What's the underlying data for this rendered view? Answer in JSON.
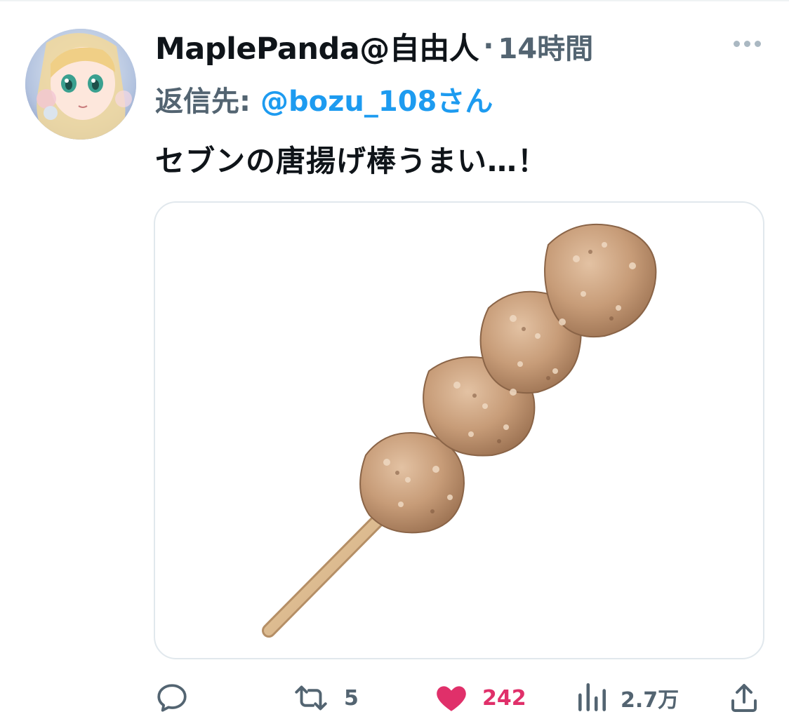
{
  "tweet": {
    "display_name": "MaplePanda@自由人",
    "separator": "·",
    "time": "14時間",
    "reply_label": "返信先:",
    "reply_handle": "@bozu_108さん",
    "text": "セブンの唐揚げ棒うまい…！"
  },
  "actions": {
    "reply_count": "",
    "retweet_count": "5",
    "like_count": "242",
    "views_count": "2.7万"
  },
  "colors": {
    "text_primary": "#0f1419",
    "text_secondary": "#536471",
    "link": "#1d9bf0",
    "like": "#e0306a"
  },
  "icons": {
    "more": "more-dots-icon",
    "reply": "reply-bubble-icon",
    "retweet": "retweet-icon",
    "like": "heart-filled-icon",
    "views": "bar-chart-icon",
    "share": "share-upload-icon"
  }
}
